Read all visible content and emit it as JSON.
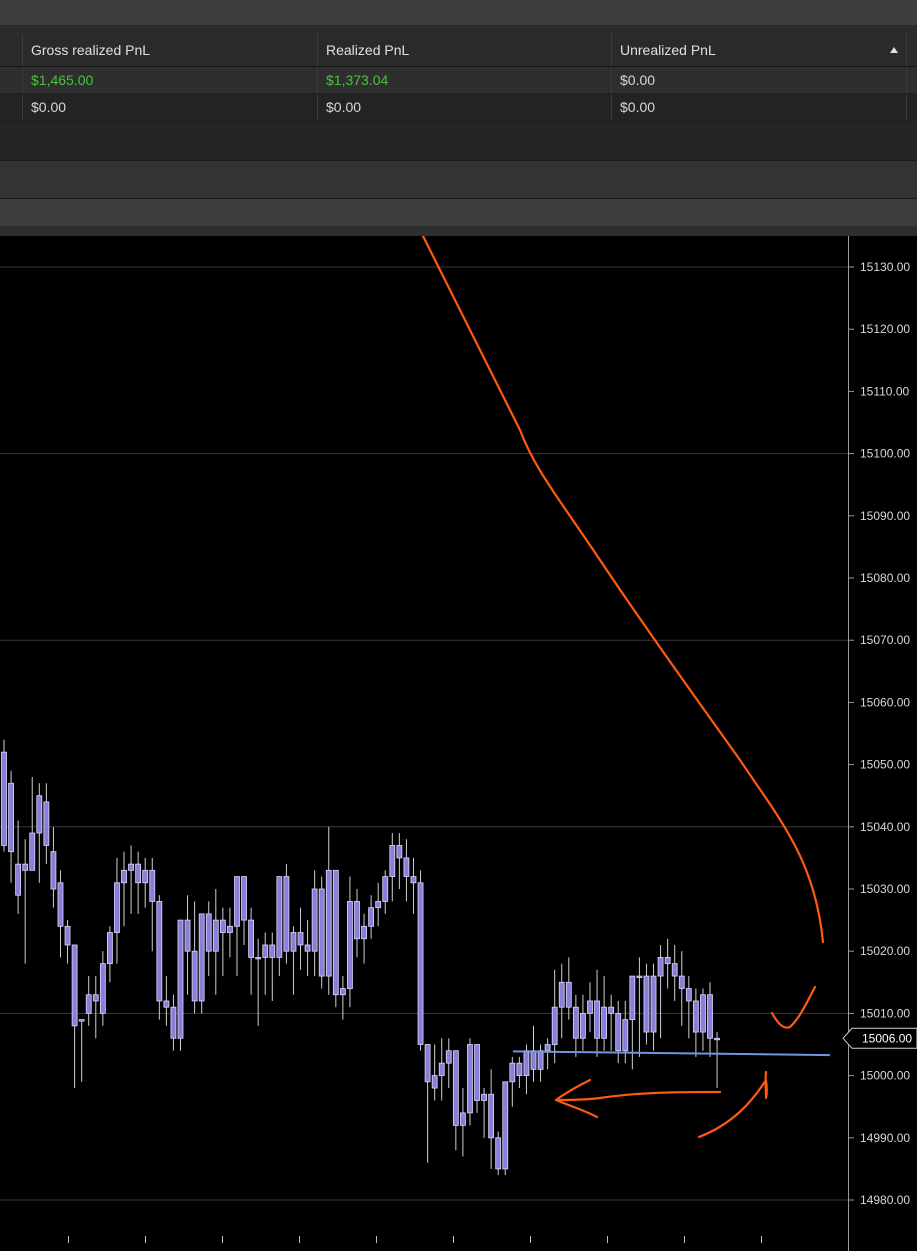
{
  "pnl_grid": {
    "columns": [
      "Gross realized PnL",
      "Realized PnL",
      "Unrealized PnL"
    ],
    "rows": [
      {
        "gross_realized": "$1,465.00",
        "realized": "$1,373.04",
        "unrealized": "$0.00"
      },
      {
        "gross_realized": "$0.00",
        "realized": "$0.00",
        "unrealized": "$0.00"
      }
    ],
    "sort_icon": "sort-ascending-icon"
  },
  "chart": {
    "current_price_label": "15006.00",
    "colors": {
      "candle_fill": "#8a7fd6",
      "candle_outline": "#d9d6ff",
      "wick": "#cfcfcf",
      "gridline": "#3a3a3a",
      "support_line": "#6f98e0",
      "annotation": "#ff5a12",
      "pnl_positive": "#45c43a"
    }
  },
  "chart_data": {
    "type": "candlestick",
    "y_tick_labels": [
      "15130.00",
      "15120.00",
      "15110.00",
      "15100.00",
      "15090.00",
      "15080.00",
      "15070.00",
      "15060.00",
      "15050.00",
      "15040.00",
      "15030.00",
      "15020.00",
      "15010.00",
      "15000.00",
      "14990.00",
      "14980.00"
    ],
    "ylim": [
      14977,
      15135
    ],
    "gridline_values": [
      15130,
      15100,
      15070,
      15040,
      15010,
      14980
    ],
    "current_price": 15006,
    "support_level": [
      15003.9,
      15003.3
    ],
    "candles": [
      [
        15052,
        15054,
        15036,
        15037
      ],
      [
        15047,
        15049,
        15031,
        15036
      ],
      [
        15034,
        15041,
        15026,
        15029
      ],
      [
        15034,
        15038,
        15018,
        15033
      ],
      [
        15033,
        15048,
        15033,
        15039
      ],
      [
        15039,
        15047,
        15031,
        15045
      ],
      [
        15044,
        15047,
        15034,
        15037
      ],
      [
        15036,
        15040,
        15027,
        15030
      ],
      [
        15031,
        15033,
        15019,
        15024
      ],
      [
        15024,
        15025,
        15018,
        15021
      ],
      [
        15021,
        14999,
        14998,
        15008
      ],
      [
        15009,
        15006,
        14999,
        15009
      ],
      [
        15010,
        15016,
        15008,
        15013
      ],
      [
        15013,
        15016,
        15006,
        15012
      ],
      [
        15010,
        15020,
        15008,
        15018
      ],
      [
        15018,
        15024,
        15015,
        15023
      ],
      [
        15023,
        15035,
        15018,
        15031
      ],
      [
        15031,
        15036,
        15024,
        15033
      ],
      [
        15033,
        15037,
        15026,
        15034
      ],
      [
        15034,
        15036,
        15026,
        15031
      ],
      [
        15031,
        15035,
        15027,
        15033
      ],
      [
        15033,
        15035,
        15020,
        15028
      ],
      [
        15028,
        15029,
        15009,
        15012
      ],
      [
        15012,
        15016,
        15008,
        15011
      ],
      [
        15011,
        15013,
        15004,
        15006
      ],
      [
        15006,
        15025,
        15004,
        15025
      ],
      [
        15025,
        15029,
        15013,
        15020
      ],
      [
        15020,
        15028,
        15010,
        15012
      ],
      [
        15012,
        15026,
        15010,
        15026
      ],
      [
        15026,
        15028,
        15016,
        15020
      ],
      [
        15020,
        15030,
        15013,
        15025
      ],
      [
        15025,
        15027,
        15016,
        15023
      ],
      [
        15023,
        15027,
        15019,
        15024
      ],
      [
        15024,
        15032,
        15016,
        15032
      ],
      [
        15032,
        15032,
        15021,
        15025
      ],
      [
        15025,
        15027,
        15013,
        15019
      ],
      [
        15019,
        15022,
        15008,
        15019
      ],
      [
        15019,
        15023,
        15013,
        15021
      ],
      [
        15021,
        15023,
        15012,
        15019
      ],
      [
        15019,
        15032,
        15016,
        15032
      ],
      [
        15032,
        15034,
        15018,
        15020
      ],
      [
        15020,
        15024,
        15013,
        15023
      ],
      [
        15023,
        15027,
        15017,
        15021
      ],
      [
        15021,
        15025,
        15016,
        15020
      ],
      [
        15020,
        15033,
        15016,
        15030
      ],
      [
        15030,
        15032,
        15014,
        15016
      ],
      [
        15016,
        15040,
        15013,
        15033
      ],
      [
        15033,
        15033,
        15011,
        15013
      ],
      [
        15013,
        15016,
        15009,
        15014
      ],
      [
        15014,
        15032,
        15011,
        15028
      ],
      [
        15028,
        15030,
        15019,
        15022
      ],
      [
        15022,
        15026,
        15018,
        15024
      ],
      [
        15024,
        15029,
        15022,
        15027
      ],
      [
        15027,
        15031,
        15024,
        15028
      ],
      [
        15028,
        15033,
        15026,
        15032
      ],
      [
        15032,
        15039,
        15028,
        15037
      ],
      [
        15037,
        15039,
        15030,
        15035
      ],
      [
        15035,
        15038,
        15028,
        15032
      ],
      [
        15032,
        15035,
        15026,
        15031
      ],
      [
        15031,
        15033,
        15004,
        15005
      ],
      [
        15005,
        15003,
        14986,
        14999
      ],
      [
        14998,
        15005,
        14996,
        15000
      ],
      [
        15000,
        15006,
        14996,
        15002
      ],
      [
        15002,
        15006,
        14998,
        15004
      ],
      [
        15004,
        14997,
        14988,
        14992
      ],
      [
        14992,
        14998,
        14987,
        14994
      ],
      [
        14994,
        15006,
        14992,
        15005
      ],
      [
        15005,
        14999,
        14994,
        14996
      ],
      [
        14996,
        14998,
        14990,
        14997
      ],
      [
        14997,
        15001,
        14985,
        14990
      ],
      [
        14990,
        14991,
        14984,
        14985
      ],
      [
        14985,
        14999,
        14984,
        14999
      ],
      [
        14999,
        15003,
        14995,
        15002
      ],
      [
        15002,
        15003,
        14998,
        15000
      ],
      [
        15000,
        15005,
        14997,
        15004
      ],
      [
        15004,
        15008,
        14999,
        15001
      ],
      [
        15001,
        15005,
        14999,
        15004
      ],
      [
        15004,
        15006,
        15001,
        15005
      ],
      [
        15005,
        15017,
        15002,
        15011
      ],
      [
        15011,
        15018,
        15006,
        15015
      ],
      [
        15015,
        15019,
        15009,
        15011
      ],
      [
        15011,
        15013,
        15003,
        15006
      ],
      [
        15006,
        15013,
        15004,
        15010
      ],
      [
        15010,
        15015,
        15007,
        15012
      ],
      [
        15012,
        15017,
        15003,
        15006
      ],
      [
        15006,
        15016,
        15004,
        15011
      ],
      [
        15011,
        15013,
        15004,
        15010
      ],
      [
        15010,
        15012,
        15002,
        15004
      ],
      [
        15004,
        15012,
        15002,
        15009
      ],
      [
        15009,
        15016,
        15001,
        15016
      ],
      [
        15016,
        15019,
        15003,
        15016
      ],
      [
        15016,
        15018,
        15005,
        15007
      ],
      [
        15007,
        15018,
        15004,
        15016
      ],
      [
        15016,
        15021,
        15006,
        15019
      ],
      [
        15019,
        15022,
        15014,
        15018
      ],
      [
        15018,
        15021,
        15012,
        15016
      ],
      [
        15016,
        15020,
        15008,
        15014
      ],
      [
        15014,
        15016,
        15006,
        15012
      ],
      [
        15012,
        15014,
        15003,
        15007
      ],
      [
        15007,
        15014,
        15004,
        15013
      ],
      [
        15013,
        15015,
        15003,
        15006
      ],
      [
        15006,
        15007,
        14998,
        15006
      ]
    ]
  },
  "annotations": {
    "color": "#ff5a12",
    "description_free": true
  }
}
